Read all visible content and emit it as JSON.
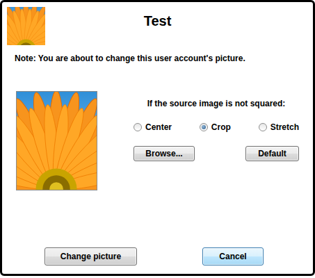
{
  "window": {
    "title": "Test"
  },
  "note": "Note: You are about to change this user account's picture.",
  "options": {
    "label": "If the source image is not squared:",
    "items": [
      {
        "label": "Center",
        "selected": false
      },
      {
        "label": "Crop",
        "selected": true
      },
      {
        "label": "Stretch",
        "selected": false
      }
    ]
  },
  "buttons": [
    {
      "label": "Browse..."
    },
    {
      "label": "Default"
    }
  ],
  "footer_buttons": [
    {
      "label": "Change picture",
      "focused": false
    },
    {
      "label": "Cancel",
      "focused": true
    }
  ]
}
